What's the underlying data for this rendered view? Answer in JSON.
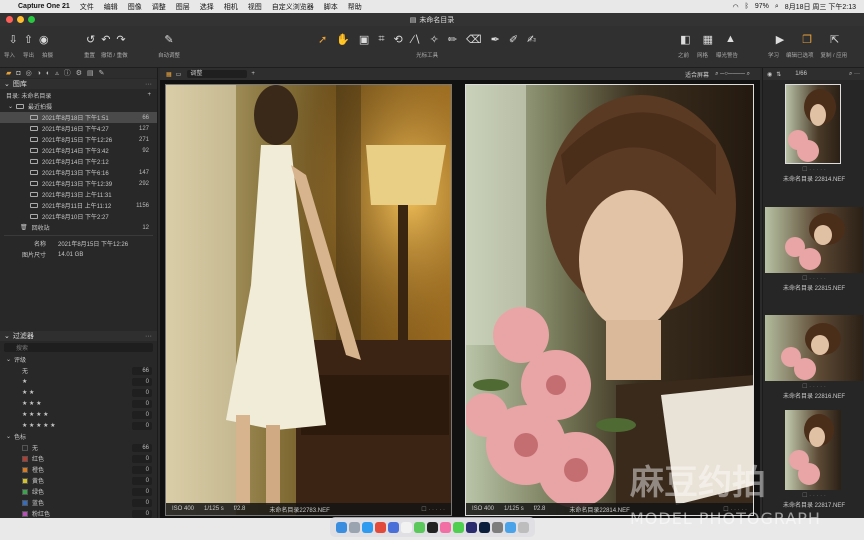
{
  "menubar": {
    "app": "Capture One 21",
    "items": [
      "文件",
      "编辑",
      "图像",
      "调整",
      "图层",
      "选择",
      "相机",
      "视图",
      "自定义浏览器",
      "脚本",
      "帮助"
    ],
    "battery": "97%",
    "datetime": "8月18日 周三 下午2:13"
  },
  "window": {
    "title": "未命名目录"
  },
  "toolbar": {
    "import": "导入",
    "export": "导出",
    "capture": "拍摄",
    "undo_redo": "撤销 / 重做",
    "reset": "重置",
    "auto_adjust": "自动调整",
    "cursor_tools": "光标工具",
    "before_after": "之前",
    "grid": "网格",
    "exposure_warning": "曝光警告",
    "learn": "学习",
    "edit_selected": "编辑已选项",
    "copy_apply": "复制 / 应用"
  },
  "library": {
    "header": "图库",
    "catalog_label": "目录: 未命名目录",
    "recent_label": "最近拍摄",
    "recent": [
      {
        "label": "2021年8月18日 下午1:51",
        "count": "66"
      },
      {
        "label": "2021年8月16日 下午4:27",
        "count": "127"
      },
      {
        "label": "2021年8月15日 下午12:26",
        "count": "271"
      },
      {
        "label": "2021年8月14日 下午3:42",
        "count": "92"
      },
      {
        "label": "2021年8月14日 下午2:12",
        "count": ""
      },
      {
        "label": "2021年8月13日 下午6:16",
        "count": "147"
      },
      {
        "label": "2021年8月13日 下午12:39",
        "count": "292"
      },
      {
        "label": "2021年8月13日 上午11:31",
        "count": ""
      },
      {
        "label": "2021年8月11日 上午11:12",
        "count": "1156"
      },
      {
        "label": "2021年8月10日 下午2:27",
        "count": ""
      }
    ],
    "trash_label": "回收站",
    "trash_count": "12",
    "name_label": "名称",
    "name_value": "2021年8月15日 下午12:26",
    "size_label": "图片尺寸",
    "size_value": "14.01 GB"
  },
  "filters": {
    "header": "过滤器",
    "search_placeholder": "搜索",
    "rating_header": "评级",
    "ratings": [
      {
        "label": "无",
        "count": "66"
      },
      {
        "label": "★",
        "count": "0"
      },
      {
        "label": "★ ★",
        "count": "0"
      },
      {
        "label": "★ ★ ★",
        "count": "0"
      },
      {
        "label": "★ ★ ★ ★",
        "count": "0"
      },
      {
        "label": "★ ★ ★ ★ ★",
        "count": "0"
      }
    ],
    "color_header": "色标",
    "colors": [
      {
        "label": "无",
        "count": "66",
        "color": "#2a2a2a"
      },
      {
        "label": "红色",
        "count": "0",
        "color": "#c0392b"
      },
      {
        "label": "橙色",
        "count": "0",
        "color": "#d97a1e"
      },
      {
        "label": "黄色",
        "count": "0",
        "color": "#d6c21f"
      },
      {
        "label": "绿色",
        "count": "0",
        "color": "#3aa54a"
      },
      {
        "label": "蓝色",
        "count": "0",
        "color": "#2f6fc9"
      },
      {
        "label": "粉红色",
        "count": "0",
        "color": "#b84fb8"
      }
    ]
  },
  "viewer": {
    "preset": "调整",
    "zoom": "适合屏幕",
    "photos": [
      {
        "iso": "ISO 400",
        "shutter": "1/125 s",
        "aperture": "f/2.8",
        "file": "未命名目录22783.NEF"
      },
      {
        "iso": "ISO 400",
        "shutter": "1/125 s",
        "aperture": "f/2.8",
        "file": "未命名目录22814.NEF"
      }
    ]
  },
  "browser": {
    "counter": "1/66",
    "thumbs": [
      {
        "file": "未命名目录 22814.NEF"
      },
      {
        "file": "未命名目录 22815.NEF"
      },
      {
        "file": "未命名目录 22816.NEF"
      },
      {
        "file": "未命名目录 22817.NEF"
      }
    ]
  },
  "watermark": {
    "cn": "麻豆约拍",
    "en": "MODEL PHOTOGRAPH"
  }
}
